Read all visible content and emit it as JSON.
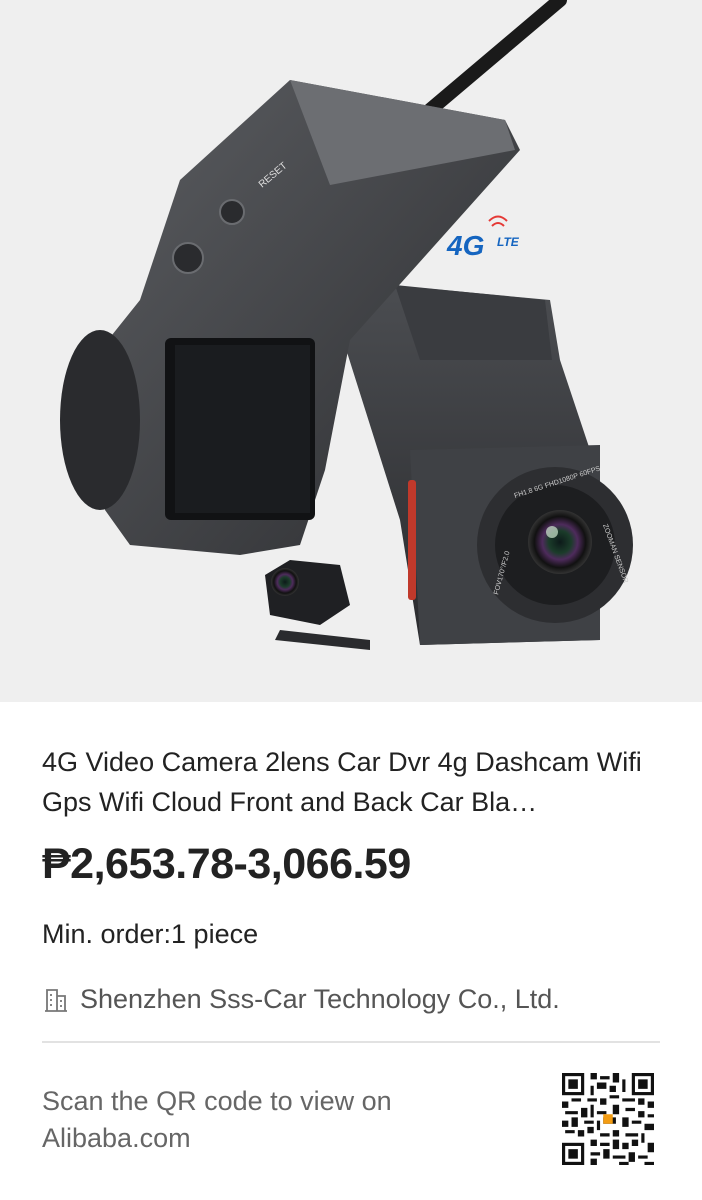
{
  "product_image": {
    "badge_main": "4G",
    "badge_sub": "LTE",
    "button_label": "RESET",
    "lens_text": "FH1.8 6G FHD1080P 60FPS",
    "lens_text_2": "FOV170°/F2.0",
    "lens_text_3": "ZOOMAN SENSOR"
  },
  "product": {
    "title": "4G Video Camera 2lens Car Dvr 4g Dashcam Wifi Gps Wifi Cloud Front and Back Car Bla…",
    "price": "₱2,653.78-3,066.59",
    "min_order": "Min. order:1 piece",
    "supplier": "Shenzhen Sss-Car Technology Co., Ltd."
  },
  "footer": {
    "scan_text": "Scan the QR code to view on Alibaba.com"
  },
  "icons": {
    "supplier": "building-icon",
    "qr": "qr-code-icon"
  },
  "colors": {
    "accent_4g": "#1565c0",
    "accent_lte": "#e53935"
  }
}
